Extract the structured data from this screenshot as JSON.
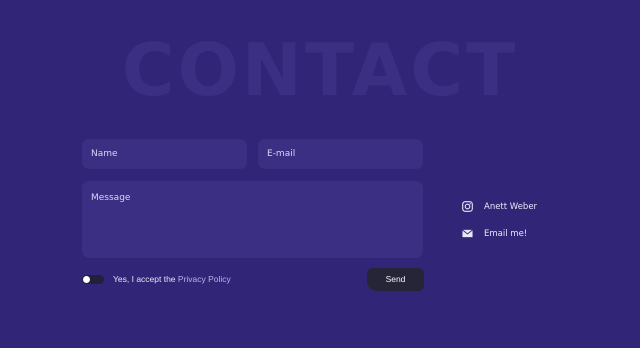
{
  "background_title": "CONTACT",
  "form": {
    "name_placeholder": "Name",
    "email_placeholder": "E-mail",
    "message_placeholder": "Message",
    "consent_prefix": "Yes, I accept the ",
    "consent_link": "Privacy Policy",
    "send_label": "Send",
    "consent_toggle_on": false
  },
  "contact_links": [
    {
      "icon": "instagram-icon",
      "label": "Anett Weber"
    },
    {
      "icon": "mail-icon",
      "label": "Email me!"
    }
  ],
  "colors": {
    "background": "#312577",
    "field": "#3a2f82",
    "button": "#262538"
  }
}
